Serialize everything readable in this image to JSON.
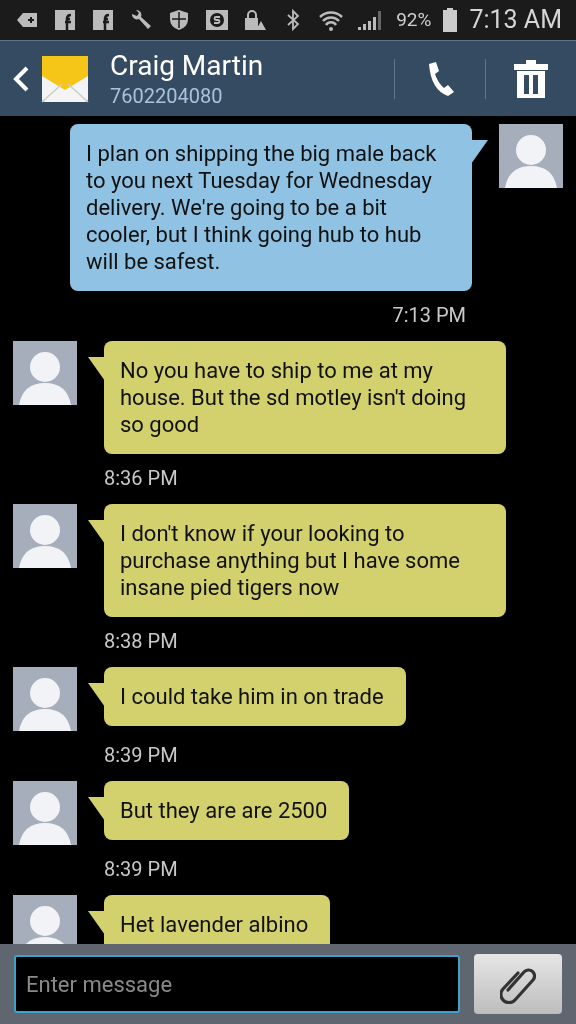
{
  "status_bar": {
    "battery": "92%",
    "time": "7:13 AM"
  },
  "header": {
    "name": "Craig Martin",
    "number": "7602204080"
  },
  "messages": [
    {
      "kind": "sent",
      "text": "I plan on shipping the big male back to you next Tuesday for Wednesday delivery. We're going to be a bit cooler, but I think going hub to hub will be safest.",
      "time": "7:13 PM"
    },
    {
      "kind": "received",
      "text": "No you have to ship to me at my house. But the sd motley isn't doing so good",
      "time": "8:36 PM"
    },
    {
      "kind": "received",
      "text": "I don't know if your looking to purchase anything but I have some insane pied tigers  now",
      "time": "8:38 PM"
    },
    {
      "kind": "received",
      "text": "I could take him in on trade",
      "time": "8:39 PM"
    },
    {
      "kind": "received",
      "text": "But they are are 2500",
      "time": "8:39 PM"
    },
    {
      "kind": "received",
      "text": "Het lavender albino"
    }
  ],
  "composer": {
    "placeholder": "Enter message"
  }
}
